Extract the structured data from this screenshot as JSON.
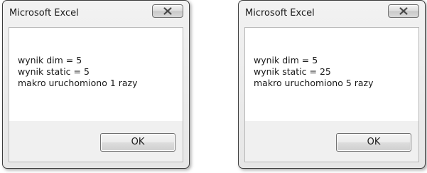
{
  "dialogs": [
    {
      "title": "Microsoft Excel",
      "close_icon": "close-x-icon",
      "lines": [
        "wynik dim = 5",
        "wynik static = 5",
        "makro uruchomiono 1 razy"
      ],
      "ok_label": "OK"
    },
    {
      "title": "Microsoft Excel",
      "close_icon": "close-x-icon",
      "lines": [
        "wynik dim = 5",
        "wynik static = 25",
        "makro uruchomiono 5 razy"
      ],
      "ok_label": "OK"
    }
  ]
}
